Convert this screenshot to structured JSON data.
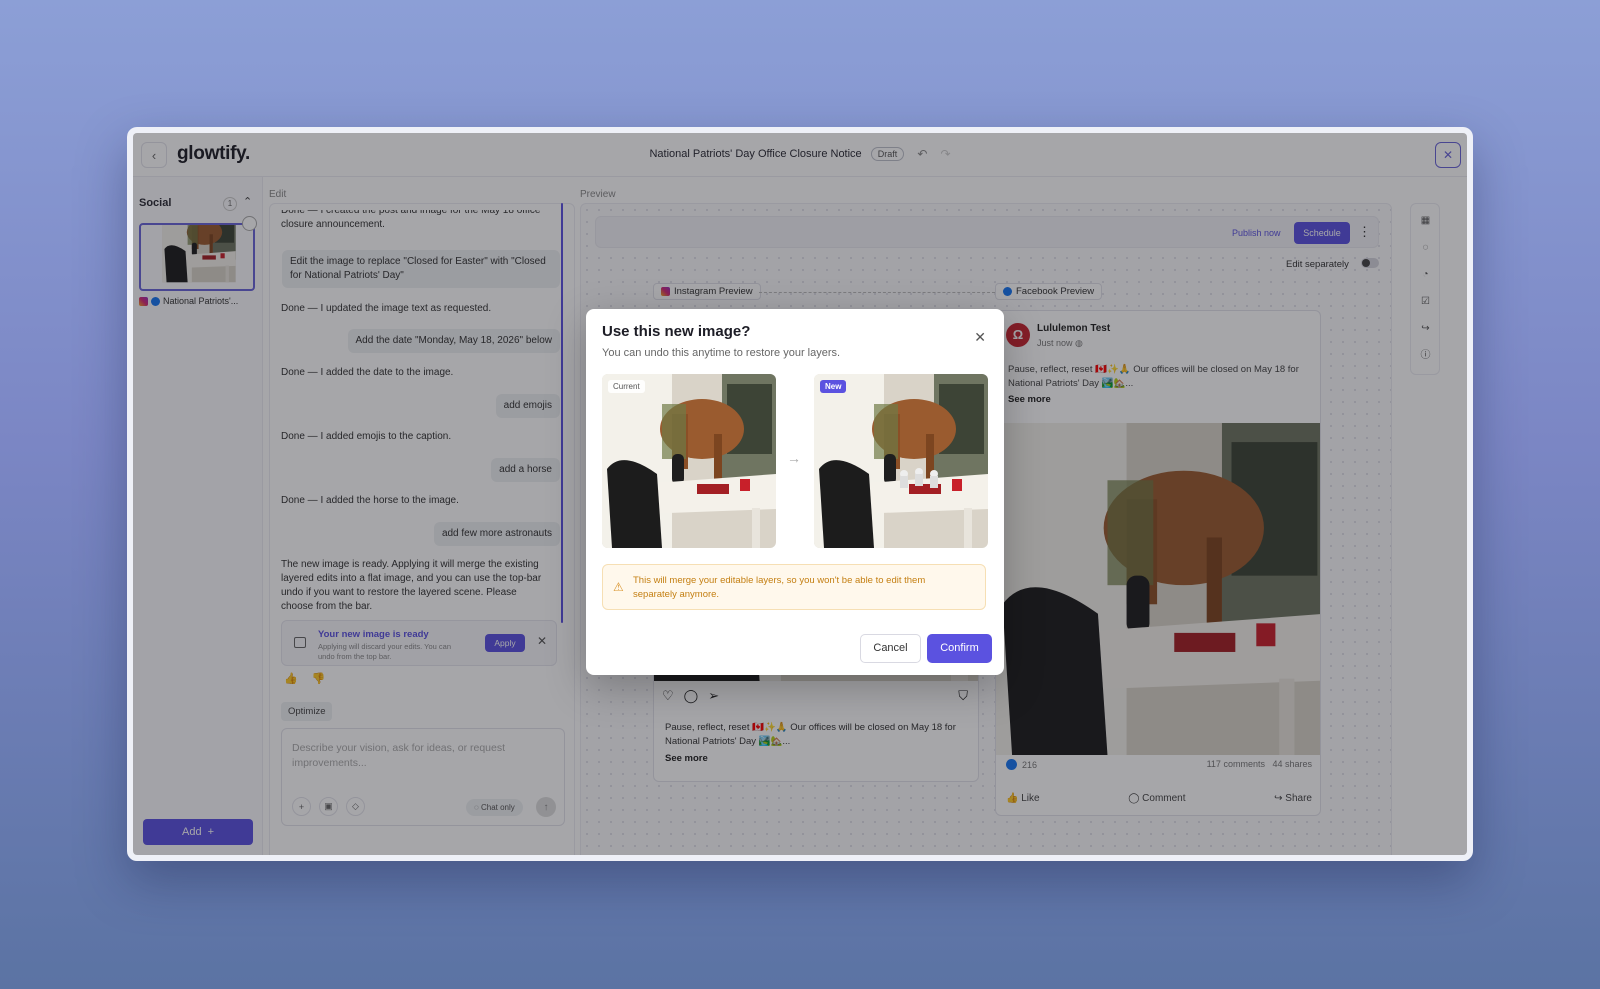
{
  "header": {
    "logo": "glowtify.",
    "title": "National Patriots' Day Office Closure Notice",
    "status_badge": "Draft"
  },
  "sidebar": {
    "section_label": "Social",
    "count": "1",
    "post_label": "National Patriots'...",
    "add_label": "Add"
  },
  "edit": {
    "label": "Edit",
    "messages": [
      {
        "role": "ai",
        "text": "Done — I created the post and image for the May 18 office closure announcement."
      },
      {
        "role": "user",
        "text": "Edit the image to replace \"Closed for Easter\" with \"Closed for National Patriots' Day\""
      },
      {
        "role": "ai",
        "text": "Done — I updated the image text as requested."
      },
      {
        "role": "user",
        "text": "Add the date \"Monday, May 18, 2026\" below"
      },
      {
        "role": "ai",
        "text": "Done — I added the date to the image."
      },
      {
        "role": "user",
        "text": "add emojis"
      },
      {
        "role": "ai",
        "text": "Done — I added emojis to the caption."
      },
      {
        "role": "user",
        "text": "add a horse"
      },
      {
        "role": "ai",
        "text": "Done — I added the horse to the image."
      },
      {
        "role": "user",
        "text": "add few more astronauts"
      },
      {
        "role": "ai",
        "text": "The new image is ready. Applying it will merge the existing layered edits into a flat image, and you can use the top-bar undo if you want to restore the layered scene. Please choose from the bar."
      }
    ],
    "ready_card": {
      "title": "Your new image is ready",
      "subtitle": "Applying will discard your edits. You can undo from the top bar.",
      "apply": "Apply"
    },
    "optimize": "Optimize",
    "composer_placeholder": "Describe your vision, ask for ideas, or request improvements...",
    "chat_only": "Chat only"
  },
  "preview": {
    "label": "Preview",
    "publish_now": "Publish now",
    "schedule": "Schedule",
    "edit_separately": "Edit separately",
    "instagram_tag": "Instagram Preview",
    "facebook_tag": "Facebook Preview",
    "instagram": {
      "caption": "Pause, reflect, reset 🇨🇦✨🙏 Our offices will be closed on May 18 for National Patriots' Day 🏞️🏡...",
      "see_more": "See more"
    },
    "facebook": {
      "page_name": "Lululemon Test",
      "time": "Just now",
      "caption": "Pause, reflect, reset 🇨🇦✨🙏 Our offices will be closed on May 18 for National Patriots' Day 🏞️🏡...",
      "see_more": "See more",
      "likes": "216",
      "comments": "117 comments",
      "shares": "44 shares",
      "like": "Like",
      "comment": "Comment",
      "share": "Share"
    }
  },
  "modal": {
    "title": "Use this new image?",
    "subtitle": "You can undo this anytime to restore your layers.",
    "current_badge": "Current",
    "new_badge": "New",
    "warning": "This will merge your editable layers, so you won't be able to edit them separately anymore.",
    "cancel": "Cancel",
    "confirm": "Confirm"
  },
  "colors": {
    "accent": "#5b52e0",
    "warning": "#c47f12"
  }
}
